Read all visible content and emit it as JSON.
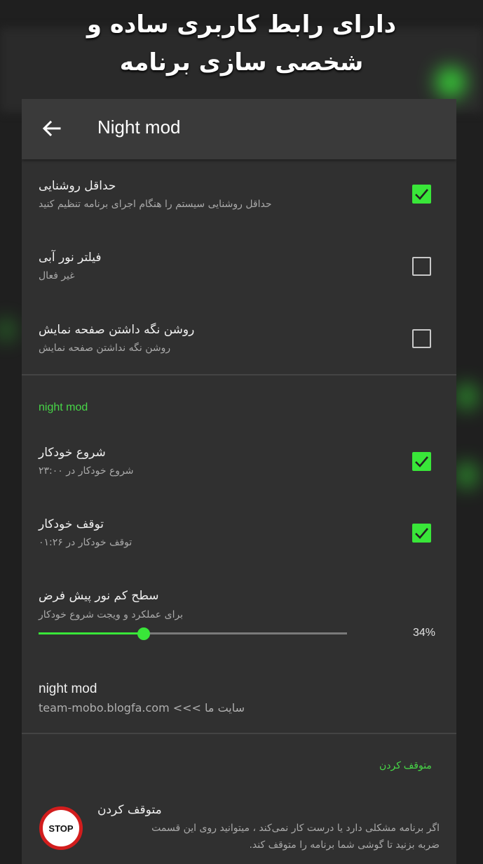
{
  "promo": {
    "line1": "دارای رابط کاربری ساده و",
    "line2": "شخصی سازی برنامه"
  },
  "toolbar": {
    "back_icon": "arrow-left-icon",
    "title": "Night mod"
  },
  "settings": [
    {
      "title": "حداقل روشنایی",
      "subtitle": "حداقل روشنایی سیستم را هنگام اجرای برنامه تنظیم کنید",
      "checked": true
    },
    {
      "title": "فیلتر نور آبی",
      "subtitle": "غیر فعال",
      "checked": false
    },
    {
      "title": "روشن نگه داشتن صفحه نمایش",
      "subtitle": "روشن نگه نداشتن صفحه نمایش",
      "checked": false
    }
  ],
  "night_section": {
    "header": "night mod",
    "auto_start": {
      "title": "شروع خودکار",
      "subtitle": "شروع خودکار در ۲۳:۰۰",
      "checked": true
    },
    "auto_stop": {
      "title": "توقف خودکار",
      "subtitle": "توقف خودکار در ۰۱:۲۶",
      "checked": true
    },
    "default_level": {
      "title": "سطح کم نور پیش فرض",
      "subtitle": "برای عملکرد و ویجت شروع خودکار",
      "value": 0.34,
      "value_label": "34%"
    },
    "site": {
      "title": "night mod",
      "subtitle": "team-mobo.blogfa.com  <<<  سایت ما"
    }
  },
  "stop_section": {
    "header": "متوقف کردن",
    "title": "متوقف کردن",
    "line1": "اگر برنامه مشکلی دارد یا درست کار نمی‌کند ، میتوانید روی این قسمت",
    "line2": "ضربه بزنید تا گوشی شما برنامه را متوقف کند.",
    "badge": "STOP",
    "icon": "stop-sign-icon"
  },
  "colors": {
    "accent": "#39e639",
    "panel": "#303030",
    "toolbar": "#3a3a3a",
    "stop_red": "#d21d1d"
  }
}
